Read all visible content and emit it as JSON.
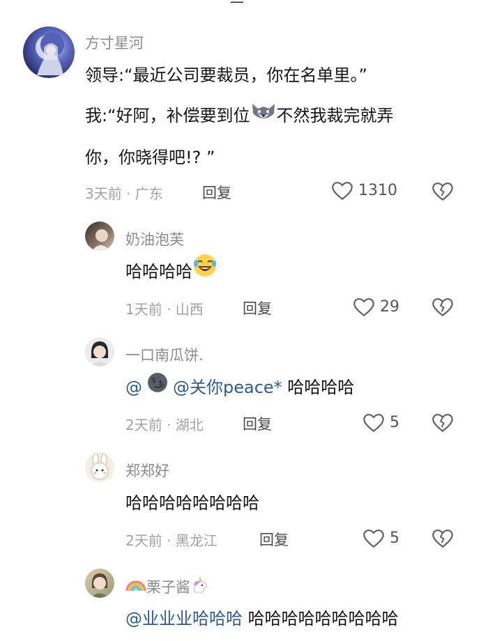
{
  "comments": [
    {
      "name": "方寸星河",
      "lines": [
        "领导:“最近公司要裁员，你在名单里。”",
        "我:“好阿，补偿要到位",
        "不然我裁完就弄",
        "你，你晓得吧!? ”"
      ],
      "emoji": "wolf-emoji",
      "meta": "3天前 · 广东",
      "reply": "回复",
      "likes": "1310"
    },
    {
      "name": "奶油泡芙",
      "text": "哈哈哈哈",
      "emoji": "laughing-crying-emoji",
      "meta": "1天前 · 山西",
      "reply": "回复",
      "likes": "29"
    },
    {
      "name": "一口南瓜饼.",
      "mention_prefix": "@",
      "mention": "@关你peace*",
      "text": " 哈哈哈哈",
      "meta": "2天前 · 湖北",
      "reply": "回复",
      "likes": "5"
    },
    {
      "name": "郑郑好",
      "text": "哈哈哈哈哈哈哈哈",
      "meta": "2天前 · 黑龙江",
      "reply": "回复",
      "likes": "5"
    },
    {
      "name": "栗子酱",
      "mention": "@业业业哈哈哈",
      "text": " 哈哈哈哈哈哈哈哈哈"
    }
  ],
  "colors": {
    "mention": "#2b5c97",
    "name": "#8c8c8c",
    "meta": "#a2a2a2"
  },
  "icons": [
    "heart-outline-icon",
    "broken-heart-icon",
    "rainbow-icon",
    "unicorn-icon"
  ]
}
